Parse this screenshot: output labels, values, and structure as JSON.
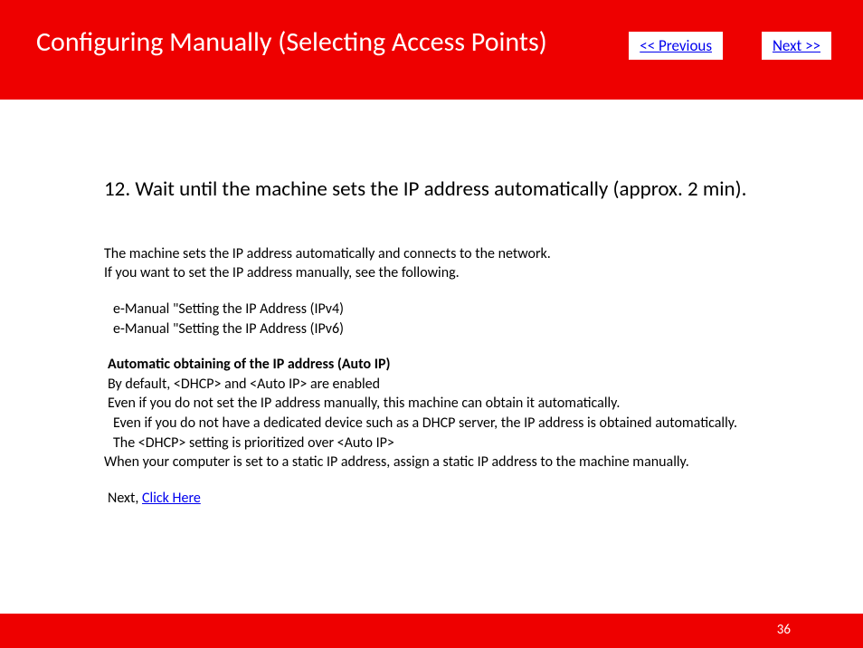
{
  "header": {
    "title": "Configuring Manually (Selecting Access Points)",
    "prev_label": "<< Previous",
    "next_label": "Next >>"
  },
  "content": {
    "step_heading": "12. Wait until the machine sets the IP address automatically (approx. 2 min).",
    "intro_line1": "The machine sets the IP address automatically and connects to the network.",
    "intro_line2": " If you want to set the IP address manually, see the following.",
    "ref1": "e-Manual \"Setting the IP Address (IPv4)",
    "ref2": "e-Manual \"Setting the IP Address (IPv6)",
    "auto_heading": "Automatic obtaining of the IP address (Auto IP)",
    "auto_line1": "By default, <DHCP> and <Auto IP> are enabled",
    "auto_line2": "Even if you do not set the IP address manually, this machine can obtain it automatically.",
    "auto_line3": "Even if you do not have a dedicated device such as a DHCP server, the IP address is obtained automatically.",
    "auto_line4": "The <DHCP> setting is prioritized over <Auto IP>",
    "auto_line5": "When your computer is set to a static IP address, assign a static IP address to the machine manually.",
    "next_prefix": "Next, ",
    "next_link": "Click Here"
  },
  "footer": {
    "page_number": "36"
  }
}
